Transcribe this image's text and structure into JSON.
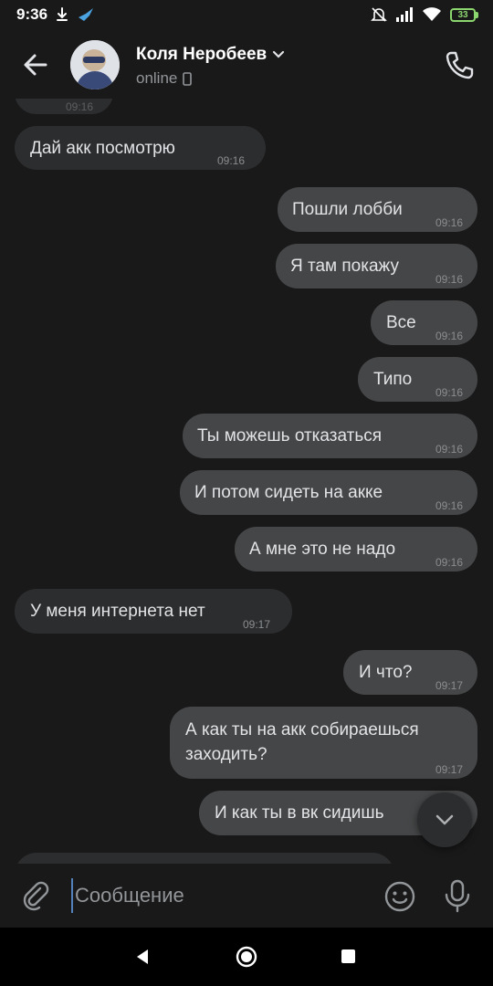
{
  "status_bar": {
    "time": "9:36",
    "battery": "33",
    "icons": [
      "download-icon",
      "bird-notification-icon",
      "mute-icon",
      "signal-icon",
      "wifi-icon",
      "battery-icon"
    ]
  },
  "header": {
    "contact_name": "Коля Неробеев",
    "status": "online",
    "icons": [
      "back-arrow-icon",
      "chevron-down-icon",
      "phone-device-icon",
      "call-icon"
    ]
  },
  "messages": [
    {
      "dir": "in",
      "text": "Дай акк посмотрю",
      "time": "09:16"
    },
    {
      "dir": "out",
      "text": "Пошли лобби",
      "time": "09:16"
    },
    {
      "dir": "out",
      "text": "Я там покажу",
      "time": "09:16"
    },
    {
      "dir": "out",
      "text": "Все",
      "time": "09:16"
    },
    {
      "dir": "out",
      "text": "Типо",
      "time": "09:16"
    },
    {
      "dir": "out",
      "text": "Ты можешь отказаться",
      "time": "09:16"
    },
    {
      "dir": "out",
      "text": "И потом сидеть на акке",
      "time": "09:16"
    },
    {
      "dir": "out",
      "text": "А мне это не надо",
      "time": "09:16"
    },
    {
      "dir": "in",
      "text": "У меня интернета нет",
      "time": "09:17"
    },
    {
      "dir": "out",
      "text": "И что?",
      "time": "09:17"
    },
    {
      "dir": "out",
      "text": "А как ты на акк собираешься\nзаходить?",
      "time": "09:17"
    },
    {
      "dir": "out",
      "text": "И как ты в вк сидишь",
      "time": ""
    }
  ],
  "top_partial_time": "09:16",
  "composer": {
    "placeholder": "Сообщение",
    "icons": [
      "paperclip-icon",
      "emoji-icon",
      "microphone-icon"
    ]
  },
  "scroll_down_icon": "chevron-down-icon",
  "nav_bar": {
    "icons": [
      "nav-back-icon",
      "nav-home-icon",
      "nav-recents-icon"
    ]
  },
  "colors": {
    "background": "#19191a",
    "incoming_bubble": "#2c2d2e",
    "outgoing_bubble": "#454647",
    "text": "#e1e3e6",
    "secondary_text": "#939699",
    "accent": "#5181b8"
  }
}
